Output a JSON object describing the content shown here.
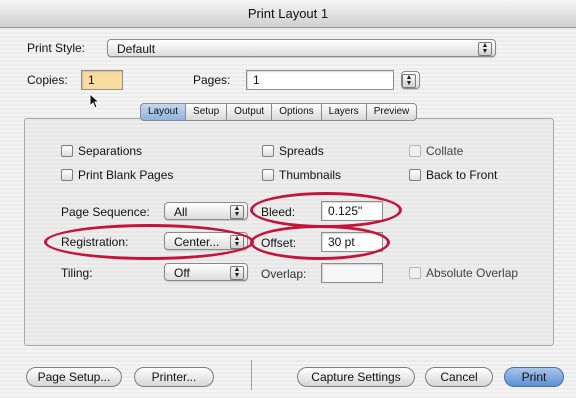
{
  "window": {
    "title": "Print Layout 1"
  },
  "print_style": {
    "label": "Print Style:",
    "value": "Default"
  },
  "copies": {
    "label": "Copies:",
    "value": "1"
  },
  "pages": {
    "label": "Pages:",
    "value": "1"
  },
  "tabs": [
    {
      "label": "Layout",
      "active": true
    },
    {
      "label": "Setup"
    },
    {
      "label": "Output"
    },
    {
      "label": "Options"
    },
    {
      "label": "Layers"
    },
    {
      "label": "Preview"
    }
  ],
  "checkboxes": {
    "separations": "Separations",
    "spreads": "Spreads",
    "collate": "Collate",
    "print_blank_pages": "Print Blank Pages",
    "thumbnails": "Thumbnails",
    "back_to_front": "Back to Front",
    "absolute_overlap": "Absolute Overlap"
  },
  "page_sequence": {
    "label": "Page Sequence:",
    "value": "All"
  },
  "bleed": {
    "label": "Bleed:",
    "value": "0.125\""
  },
  "registration": {
    "label": "Registration:",
    "value": "Center..."
  },
  "offset": {
    "label": "Offset:",
    "value": "30 pt"
  },
  "tiling": {
    "label": "Tiling:",
    "value": "Off"
  },
  "overlap": {
    "label": "Overlap:",
    "value": ""
  },
  "buttons": {
    "page_setup": "Page Setup...",
    "printer": "Printer...",
    "capture_settings": "Capture Settings",
    "cancel": "Cancel",
    "print": "Print"
  },
  "colors": {
    "highlight_ring": "#c4143a",
    "copies_field": "#f9dca0",
    "default_button": "#5b8fd2"
  },
  "icons": {
    "popup_arrows": "updown-arrows-icon",
    "cursor": "arrow-cursor-icon"
  }
}
